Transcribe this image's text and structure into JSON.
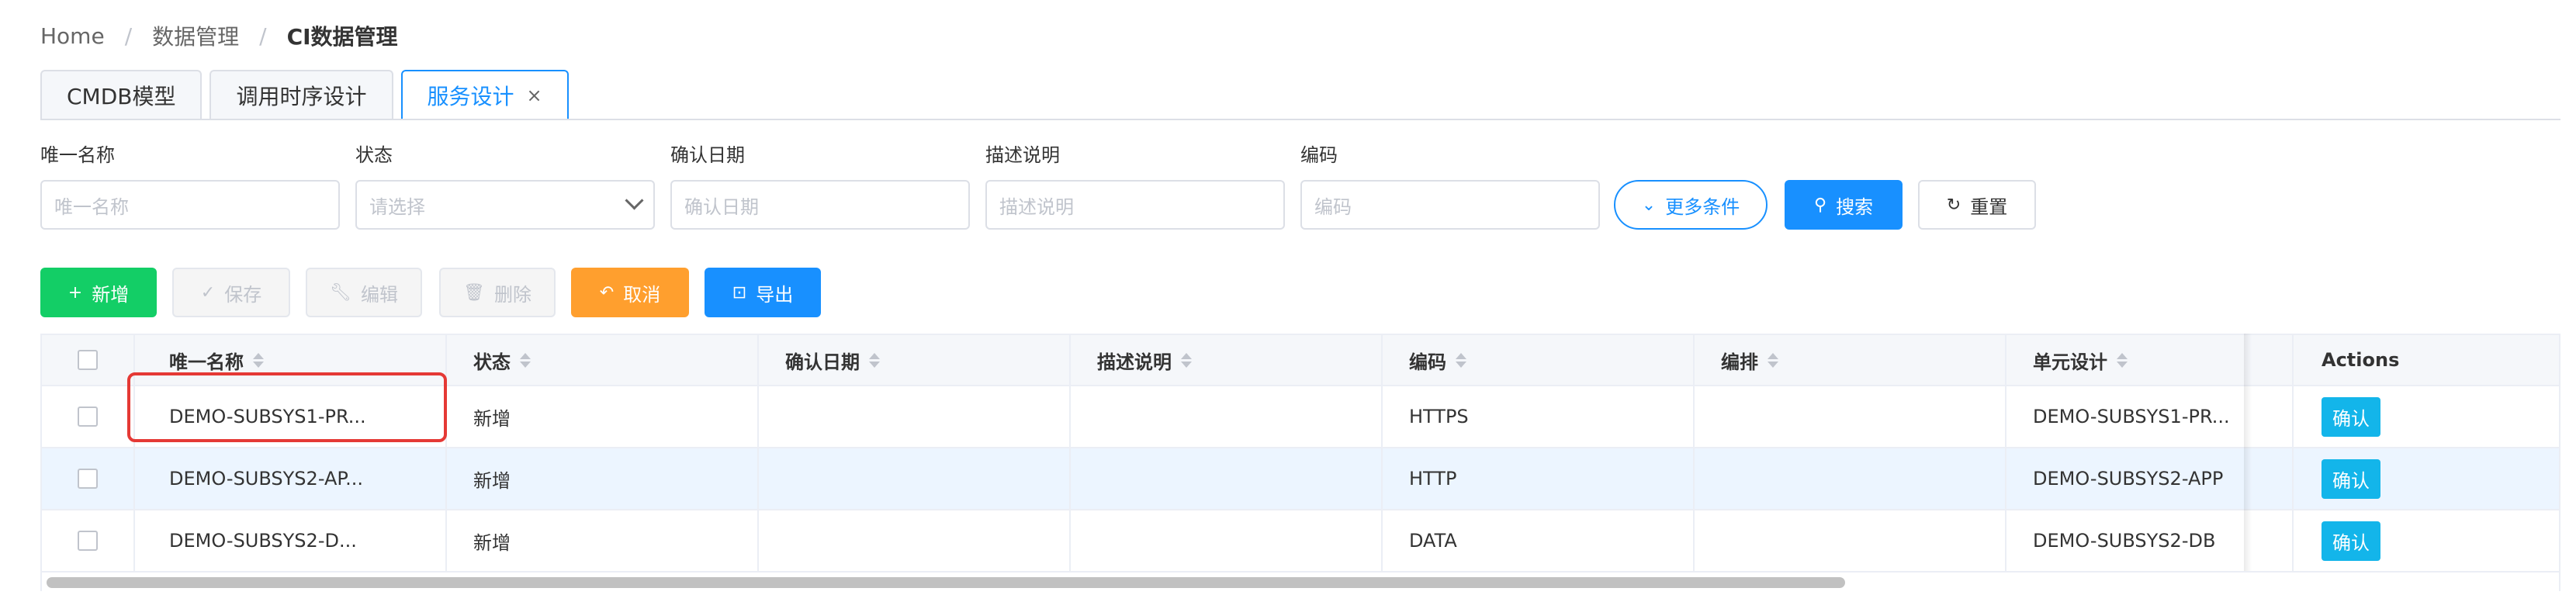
{
  "breadcrumb": {
    "home": "Home",
    "level2": "数据管理",
    "current": "CI数据管理",
    "separator": "/"
  },
  "tabs": [
    {
      "label": "CMDB模型"
    },
    {
      "label": "调用时序设计"
    },
    {
      "label": "服务设计",
      "close": "×"
    }
  ],
  "filters": [
    {
      "label": "唯一名称",
      "placeholder": "唯一名称"
    },
    {
      "label": "状态",
      "placeholder": "请选择"
    },
    {
      "label": "确认日期",
      "placeholder": "确认日期"
    },
    {
      "label": "描述说明",
      "placeholder": "描述说明"
    },
    {
      "label": "编码",
      "placeholder": "编码"
    }
  ],
  "filter_buttons": {
    "more": {
      "icon": "chevron-down-icon",
      "glyph": "⌄",
      "label": "更多条件"
    },
    "search": {
      "icon": "search-icon",
      "glyph": "⚲",
      "label": "搜索"
    },
    "reset": {
      "icon": "refresh-icon",
      "glyph": "↻",
      "label": "重置"
    }
  },
  "toolbar": {
    "add": {
      "icon": "plus-icon",
      "glyph": "+",
      "label": "新增"
    },
    "save": {
      "icon": "check-icon",
      "glyph": "✓",
      "label": "保存"
    },
    "edit": {
      "icon": "wrench-icon",
      "glyph": "🔧︎",
      "label": "编辑"
    },
    "delete": {
      "icon": "trash-icon",
      "glyph": "🗑︎",
      "label": "删除"
    },
    "cancel": {
      "icon": "undo-icon",
      "glyph": "↶",
      "label": "取消"
    },
    "export": {
      "icon": "export-icon",
      "glyph": "⊡",
      "label": "导出"
    }
  },
  "table": {
    "columns": [
      "唯一名称",
      "状态",
      "确认日期",
      "描述说明",
      "编码",
      "编排",
      "单元设计",
      "Actions"
    ],
    "rows": [
      {
        "name": "DEMO-SUBSYS1-PR...",
        "status": "新增",
        "date": "",
        "desc": "",
        "code": "HTTPS",
        "arrange": "",
        "unit": "DEMO-SUBSYS1-PR...",
        "action": "确认"
      },
      {
        "name": "DEMO-SUBSYS2-AP...",
        "status": "新增",
        "date": "",
        "desc": "",
        "code": "HTTP",
        "arrange": "",
        "unit": "DEMO-SUBSYS2-APP",
        "action": "确认"
      },
      {
        "name": "DEMO-SUBSYS2-D...",
        "status": "新增",
        "date": "",
        "desc": "",
        "code": "DATA",
        "arrange": "",
        "unit": "DEMO-SUBSYS2-DB",
        "action": "确认"
      }
    ]
  },
  "colors": {
    "primary": "#1890ff",
    "success": "#13ce66",
    "warning": "#ff9f2e",
    "confirm": "#13b5ea",
    "highlight": "#e53935"
  }
}
